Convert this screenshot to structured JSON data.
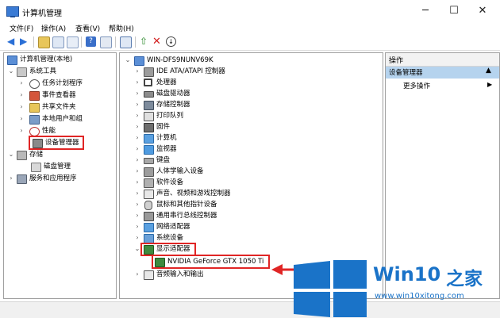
{
  "window": {
    "title": "计算机管理",
    "minimize": "─",
    "maximize": "☐",
    "close": "✕"
  },
  "menu": [
    "文件(F)",
    "操作(A)",
    "查看(V)",
    "帮助(H)"
  ],
  "left_tree": {
    "root": "计算机管理(本地)",
    "system_tools": "系统工具",
    "items": [
      "任务计划程序",
      "事件查看器",
      "共享文件夹",
      "本地用户和组",
      "性能",
      "设备管理器"
    ],
    "storage": "存储",
    "disk_mgmt": "磁盘管理",
    "services": "服务和应用程序"
  },
  "device_tree": {
    "computer": "WIN-DFS9NUNV69K",
    "categories": [
      "IDE ATA/ATAPI 控制器",
      "处理器",
      "磁盘驱动器",
      "存储控制器",
      "打印队列",
      "固件",
      "计算机",
      "监视器",
      "键盘",
      "人体学输入设备",
      "软件设备",
      "声音、视频和游戏控制器",
      "鼠标和其他指针设备",
      "通用串行总线控制器",
      "网络适配器",
      "系统设备",
      "显示适配器"
    ],
    "gpu": "NVIDIA GeForce GTX 1050 Ti",
    "last": "音频输入和输出"
  },
  "actions": {
    "header": "操作",
    "section": "设备管理器",
    "more": "更多操作"
  },
  "watermark": {
    "brand": "Win10",
    "suffix": "之家",
    "url": "www.win10xitong.com"
  },
  "colors": {
    "highlight": "#e02525",
    "selection": "#b5d3ee",
    "brand_blue": "#1a73c8"
  }
}
